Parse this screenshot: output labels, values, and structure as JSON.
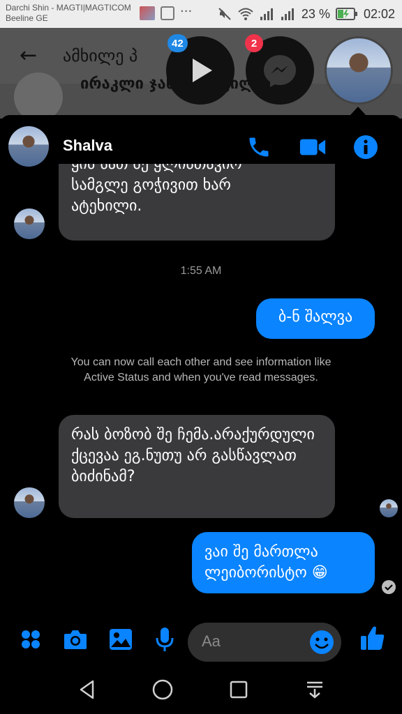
{
  "status_bar": {
    "carrier_line1": "Darchi Shin - MAGTI|MAGTICOM",
    "carrier_line2": "Beeline GE",
    "battery_percent": "23 %",
    "time": "02:02"
  },
  "background_app": {
    "title": "ამხილე პ",
    "row_text": "ირაკლი ჯანყარაშვილი"
  },
  "chat_heads": [
    {
      "name": "video-chathead",
      "badge": "42",
      "badge_color": "#1f88e5"
    },
    {
      "name": "messenger-chathead",
      "badge": "2",
      "badge_color": "#f0334b"
    }
  ],
  "chat": {
    "contact_name": "Shalva",
    "accent": "#0a84ff",
    "messages": [
      {
        "dir": "in",
        "text": "ყის სათ შე ყლისთავიო",
        "partial": true
      },
      {
        "dir": "in",
        "text": "სამგლე გოჭივით ხარ"
      },
      {
        "dir": "in",
        "text": "ატეხილი."
      },
      {
        "type": "time",
        "text": "1:55 AM"
      },
      {
        "dir": "out",
        "text": "ბ-ნ შალვა"
      },
      {
        "type": "notice",
        "text": "You can now call each other and see information like Active Status and when you've read messages."
      },
      {
        "dir": "in",
        "text": "რას ბოზობ შე ჩემა.არაქურდული ქცევაა ეგ.ნუთუ არ გასწავლათ ბიძინამ?"
      },
      {
        "dir": "out",
        "text": "ვაი შე მართლა ლეიბორისტო 😁"
      }
    ]
  },
  "composer": {
    "placeholder": "Aa"
  }
}
